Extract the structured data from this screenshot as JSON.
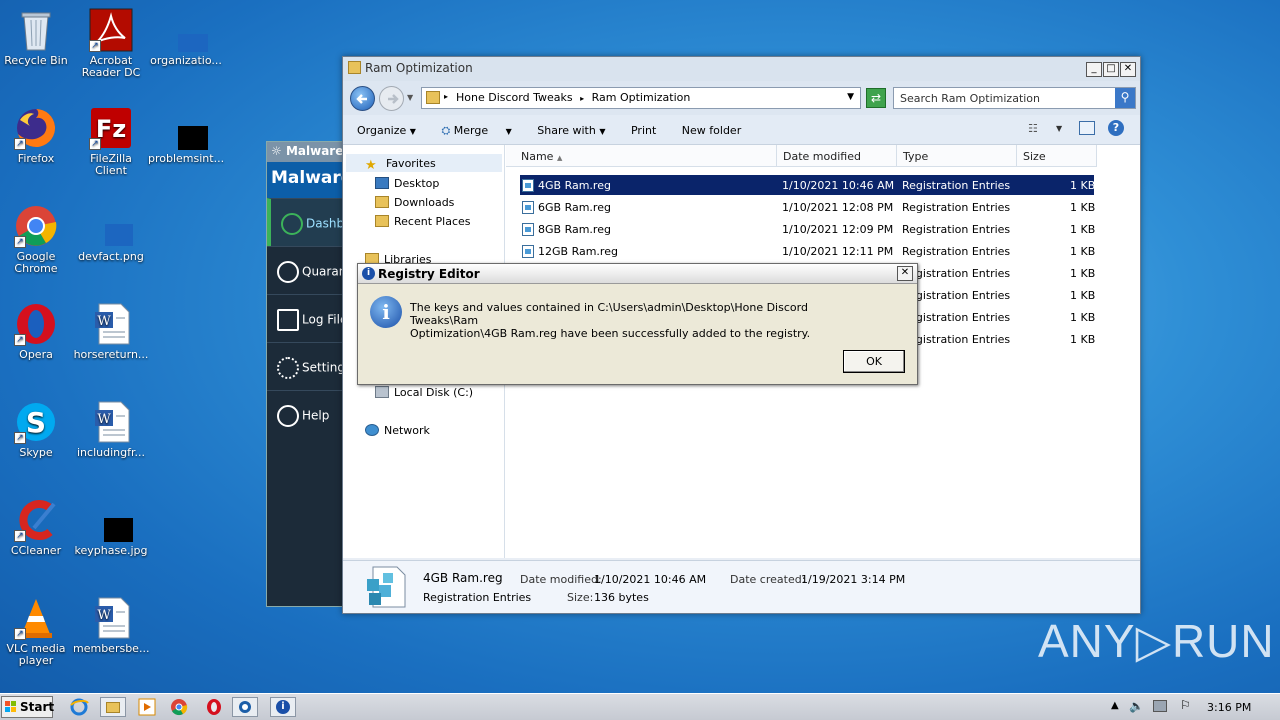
{
  "desktop": {
    "icons": [
      {
        "label": "Recycle Bin"
      },
      {
        "label": "Acrobat Reader DC"
      },
      {
        "label": "organizatio..."
      },
      {
        "label": "Firefox"
      },
      {
        "label": "FileZilla Client"
      },
      {
        "label": "problemsint..."
      },
      {
        "label": "Google Chrome"
      },
      {
        "label": "devfact.png"
      },
      {
        "label": "Opera"
      },
      {
        "label": "horsereturn..."
      },
      {
        "label": "Skype"
      },
      {
        "label": "includingfr..."
      },
      {
        "label": "CCleaner"
      },
      {
        "label": "keyphase.jpg"
      },
      {
        "label": "VLC media player"
      },
      {
        "label": "membersbe..."
      }
    ]
  },
  "malwarebytes": {
    "title": "Malwareb",
    "brand": "Malware",
    "nav": [
      {
        "label": "Dashb"
      },
      {
        "label": "Quaran"
      },
      {
        "label": "Log File"
      },
      {
        "label": "Setting"
      },
      {
        "label": "Help"
      }
    ]
  },
  "explorer": {
    "title": "Ram Optimization",
    "breadcrumb": [
      "Hone Discord Tweaks",
      "Ram Optimization"
    ],
    "search_placeholder": "Search Ram Optimization",
    "toolbar": {
      "organize": "Organize",
      "merge": "Merge",
      "share_with": "Share with",
      "print": "Print",
      "new_folder": "New folder"
    },
    "nav_pane": {
      "favorites": "Favorites",
      "desktop": "Desktop",
      "downloads": "Downloads",
      "recent": "Recent Places",
      "libraries": "Libraries",
      "local_disk": "Local Disk (C:)",
      "network": "Network"
    },
    "columns": {
      "name": "Name",
      "date": "Date modified",
      "type": "Type",
      "size": "Size"
    },
    "files": [
      {
        "name": "4GB Ram.reg",
        "date": "1/10/2021 10:46 AM",
        "type": "Registration Entries",
        "size": "1 KB"
      },
      {
        "name": "6GB Ram.reg",
        "date": "1/10/2021 12:08 PM",
        "type": "Registration Entries",
        "size": "1 KB"
      },
      {
        "name": "8GB Ram.reg",
        "date": "1/10/2021 12:09 PM",
        "type": "Registration Entries",
        "size": "1 KB"
      },
      {
        "name": "12GB Ram.reg",
        "date": "1/10/2021 12:11 PM",
        "type": "Registration Entries",
        "size": "1 KB"
      },
      {
        "name": "",
        "date": "",
        "type": "Registration Entries",
        "size": "1 KB"
      },
      {
        "name": "",
        "date": "",
        "type": "Registration Entries",
        "size": "1 KB"
      },
      {
        "name": "",
        "date": "",
        "type": "Registration Entries",
        "size": "1 KB"
      },
      {
        "name": "",
        "date": "",
        "type": "Registration Entries",
        "size": "1 KB"
      }
    ],
    "details": {
      "filename": "4GB Ram.reg",
      "filetype": "Registration Entries",
      "date_modified_label": "Date modified:",
      "date_modified": "1/10/2021 10:46 AM",
      "date_created_label": "Date created:",
      "date_created": "1/19/2021 3:14 PM",
      "size_label": "Size:",
      "size": "136 bytes"
    }
  },
  "dialog": {
    "title": "Registry Editor",
    "message_line1": "The keys and values contained in C:\\Users\\admin\\Desktop\\Hone Discord Tweaks\\Ram",
    "message_line2": "Optimization\\4GB Ram.reg have been successfully added to the registry.",
    "ok": "OK",
    "close": "✕"
  },
  "taskbar": {
    "start": "Start",
    "clock": "3:16 PM"
  },
  "watermark": "ANY▷RUN",
  "colors": {
    "selection": "#0a246a",
    "desktop": "#1a6fc0",
    "malwarebytes_accent": "#3cb35a"
  }
}
